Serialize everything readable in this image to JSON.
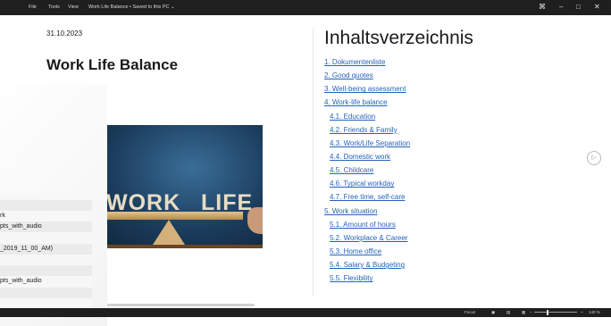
{
  "titlebar": {
    "menu": [
      "File",
      "Tools",
      "View"
    ],
    "doc_title": "Work Life Balance • Saved to this PC ⌄",
    "icons": [
      "focus-icon",
      "minimize-icon",
      "maximize-icon",
      "close-icon"
    ],
    "glyphs": {
      "focus": "⌘",
      "minimize": "–",
      "maximize": "□",
      "close": "✕"
    }
  },
  "page": {
    "date": "31.10.2023",
    "title": "Work Life Balance",
    "hero": {
      "left_word": "WORK",
      "right_word": "LIFE"
    }
  },
  "toc": {
    "title": "Inhaltsverzeichnis",
    "items": [
      {
        "label": "1. Dokumentenliste",
        "level": 1
      },
      {
        "label": "2. Good quotes",
        "level": 1
      },
      {
        "label": "3. Well-being assessment",
        "level": 1
      },
      {
        "label": "4. Work-life balance",
        "level": 1
      },
      {
        "label": "4.1. Education",
        "level": 2
      },
      {
        "label": "4.2. Friends & Family",
        "level": 2
      },
      {
        "label": "4.3. Work/Life Separation",
        "level": 2
      },
      {
        "label": "4.4. Domestic work",
        "level": 2
      },
      {
        "label": "4.5. Childcare",
        "level": 2
      },
      {
        "label": "4.6. Typical workday",
        "level": 2
      },
      {
        "label": "4.7. Free time, self-care",
        "level": 2
      },
      {
        "label": "5. Work situation",
        "level": 1
      },
      {
        "label": "5.1. Amount of hours",
        "level": 2
      },
      {
        "label": "5.2. Workplace & Career",
        "level": 2
      },
      {
        "label": "5.3. Home office",
        "level": 2
      },
      {
        "label": "5.4. Salary & Budgeting",
        "level": 2
      },
      {
        "label": "5.5. Flexibility",
        "level": 2
      }
    ]
  },
  "overlay": {
    "rows": [
      "",
      "rk",
      "pts_with_audio",
      "",
      "_2019_11_00_AM)",
      "",
      "",
      "pts_with_audio",
      ""
    ]
  },
  "statusbar": {
    "focus": "Focus",
    "zoom": "140 %",
    "zoom_minus": "–",
    "zoom_plus": "+",
    "zoom_level": 0.3
  },
  "next_glyph": "▷"
}
